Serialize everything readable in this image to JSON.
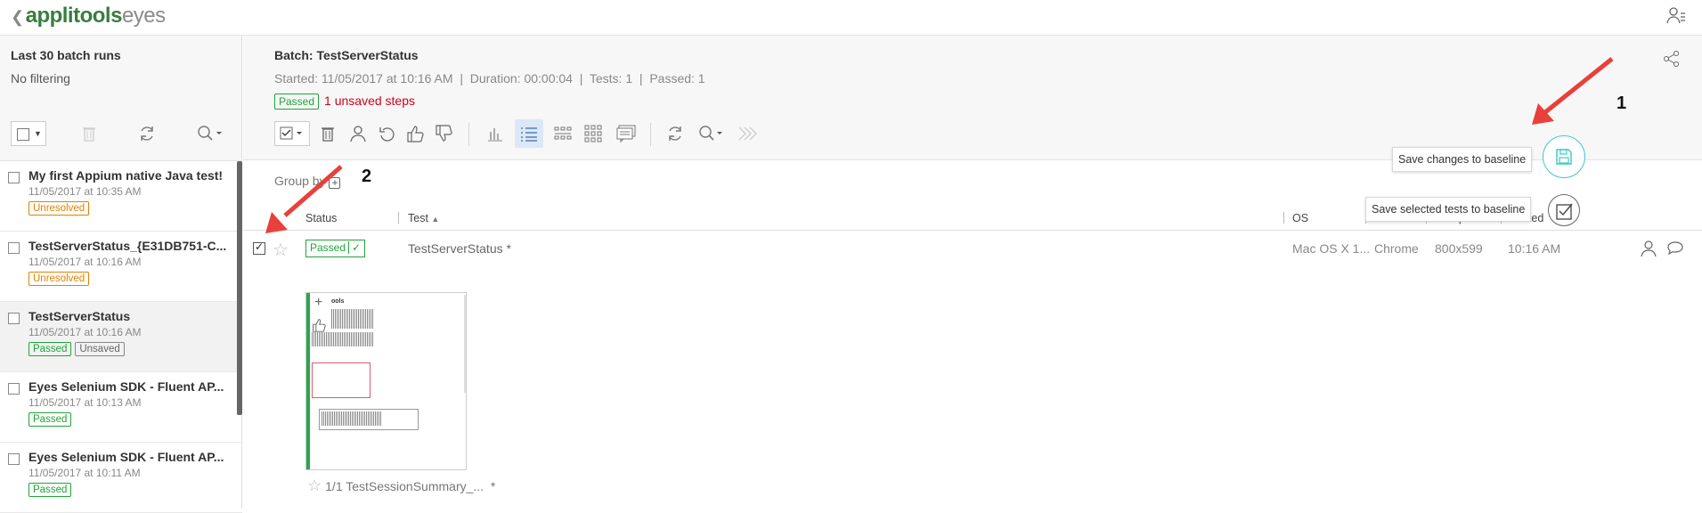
{
  "app": {
    "logo_strong": "applitools",
    "logo_light": "eyes"
  },
  "sidebar": {
    "title": "Last 30 batch runs",
    "filter": "No filtering",
    "items": [
      {
        "name": "My first Appium native Java test!",
        "date": "11/05/2017 at 10:35 AM",
        "badges": [
          "Unresolved"
        ]
      },
      {
        "name": "TestServerStatus_{E31DB751-C...",
        "date": "11/05/2017 at 10:16 AM",
        "badges": [
          "Unresolved"
        ]
      },
      {
        "name": "TestServerStatus",
        "date": "11/05/2017 at 10:16 AM",
        "badges": [
          "Passed",
          "Unsaved"
        ]
      },
      {
        "name": "Eyes Selenium SDK - Fluent AP...",
        "date": "11/05/2017 at 10:13 AM",
        "badges": [
          "Passed"
        ]
      },
      {
        "name": "Eyes Selenium SDK - Fluent AP...",
        "date": "11/05/2017 at 10:11 AM",
        "badges": [
          "Passed"
        ]
      }
    ]
  },
  "batch": {
    "title": "Batch: TestServerStatus",
    "meta": "Started: 11/05/2017 at 10:16 AM  |  Duration: 00:00:04  |  Tests: 1  |  Passed: 1",
    "status": "Passed",
    "unsaved_steps": "1 unsaved steps"
  },
  "groupby": "Group by",
  "columns": {
    "status": "Status",
    "test": "Test",
    "os": "OS",
    "browser": "Browser",
    "viewport": "Viewport",
    "started": "Started"
  },
  "row": {
    "status": "Passed",
    "test": "TestServerStatus *",
    "os": "Mac OS X 1...",
    "browser": "Chrome",
    "viewport": "800x599",
    "time": "10:16 AM"
  },
  "thumbnail": {
    "caption": "1/1 TestSessionSummary_...",
    "asterisk": "*",
    "text": "ools"
  },
  "popups": {
    "save_changes": "Save changes to baseline",
    "save_selected": "Save selected tests to baseline"
  },
  "annotations": {
    "one": "1",
    "two": "2",
    "color": "#e8403a"
  },
  "colors": {
    "passed": "#22a33b",
    "unresolved": "#e38100",
    "unsaved_text": "#d0021b",
    "teal": "#3cc8c0"
  }
}
